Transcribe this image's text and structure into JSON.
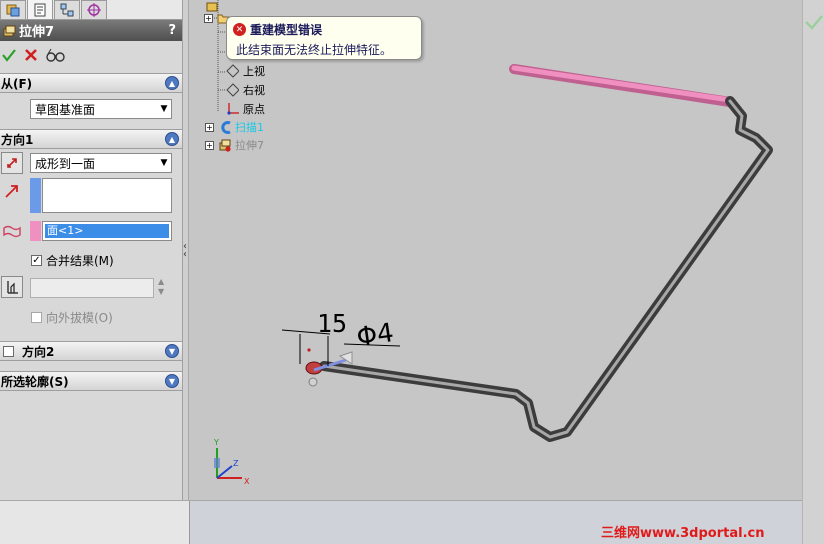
{
  "panel": {
    "title": "拉伸7",
    "help": "?",
    "ok_icon": "check-icon",
    "cancel_icon": "x-icon",
    "preview_icon": "glasses-icon"
  },
  "from": {
    "header": "从(F)",
    "value": "草图基准面"
  },
  "direction1": {
    "header": "方向1",
    "end_condition": "成形到一面",
    "face_value": "面<1>",
    "merge_label": "合并结果(M)",
    "merge_checked": true,
    "draft_label": "向外拔模(O)"
  },
  "direction2": {
    "header": "方向2"
  },
  "contours": {
    "header": "所选轮廓(S)"
  },
  "tree": {
    "items": [
      {
        "label": "上视"
      },
      {
        "label": "右视"
      },
      {
        "label": "原点"
      },
      {
        "label": "扫描1"
      },
      {
        "label": "拉伸7"
      }
    ]
  },
  "tooltip": {
    "title": "重建模型错误",
    "message": "此结束面无法终止拉伸特征。"
  },
  "dimensions": {
    "length": "15",
    "diameter": "Φ4"
  },
  "triad": {
    "x": "X",
    "y": "Y",
    "z": "Z"
  },
  "watermark": "三维网www.3dportal.cn",
  "colors": {
    "accent_blue": "#4e78c0",
    "selection": "#3b8de8",
    "face_pink": "#f090c0",
    "error_red": "#d02020",
    "watermark_red": "#e01a1a"
  }
}
